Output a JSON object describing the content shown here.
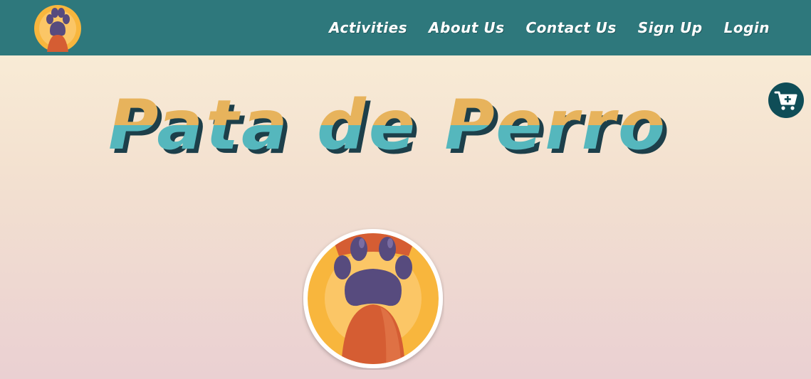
{
  "nav": {
    "logo_icon": "paw-logo-icon",
    "links": [
      {
        "label": "Activities"
      },
      {
        "label": "About Us"
      },
      {
        "label": "Contact Us"
      },
      {
        "label": "Sign Up"
      },
      {
        "label": "Login"
      }
    ]
  },
  "cart": {
    "icon": "cart-plus-icon"
  },
  "hero": {
    "title": "Pata de Perro",
    "image_icon": "paw-badge-icon"
  },
  "colors": {
    "navbar": "#2e787c",
    "title_top": "#e7b35c",
    "title_bottom": "#55b7bd",
    "title_shadow": "#1d3f4a",
    "cart": "#0f4d57",
    "paw_pad": "#574b7e",
    "paw_leg": "#d55d33",
    "badge": "#f8b63d"
  }
}
